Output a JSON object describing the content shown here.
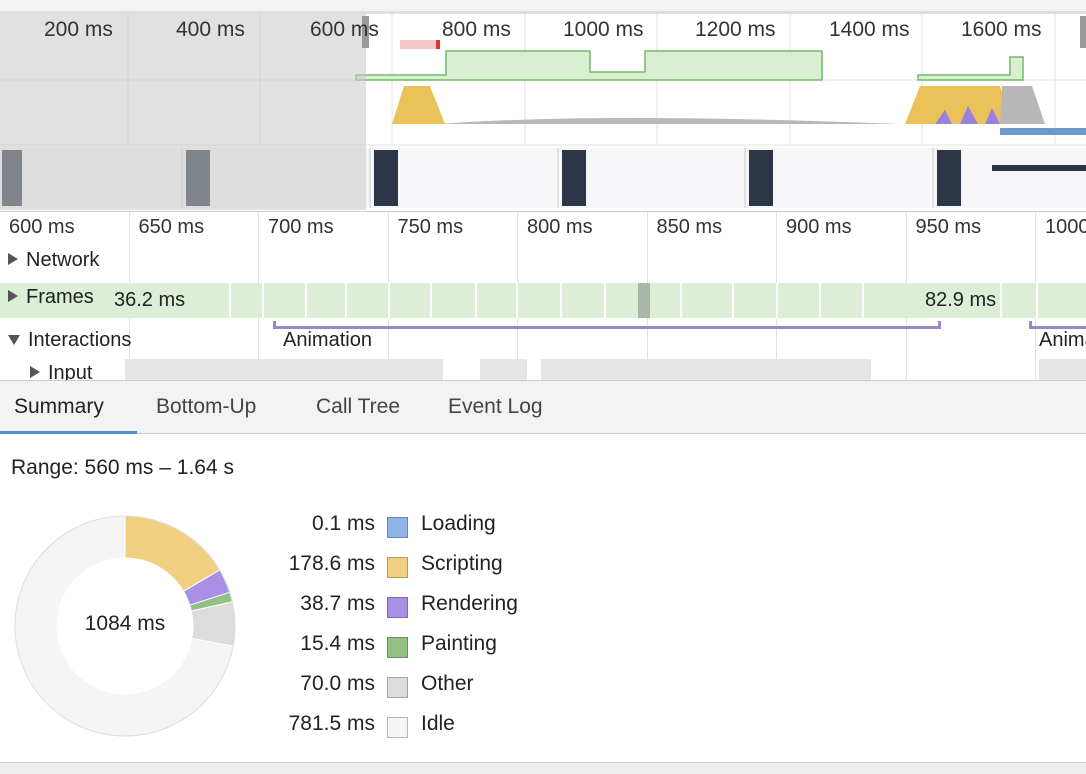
{
  "overview": {
    "time_labels": [
      "200 ms",
      "400 ms",
      "600 ms",
      "800 ms",
      "1000 ms",
      "1200 ms",
      "1400 ms",
      "1600 ms"
    ]
  },
  "detail": {
    "ruler": [
      "600 ms",
      "650 ms",
      "700 ms",
      "750 ms",
      "800 ms",
      "850 ms",
      "900 ms",
      "950 ms",
      "1000 ms"
    ],
    "tracks": {
      "network": "Network",
      "frames": "Frames",
      "interactions": "Interactions",
      "input": "Input"
    },
    "frame_labels": [
      "36.2 ms",
      "82.9 ms"
    ],
    "interaction_labels": [
      "Animation",
      "Animation"
    ]
  },
  "tabs": [
    {
      "label": "Summary",
      "active": true
    },
    {
      "label": "Bottom-Up"
    },
    {
      "label": "Call Tree"
    },
    {
      "label": "Event Log"
    }
  ],
  "summary": {
    "range": "Range: 560 ms – 1.64 s",
    "total": "1084 ms",
    "items": [
      {
        "value": "0.1 ms",
        "name": "Loading",
        "ms": 0.1,
        "color": "#8fb4ea"
      },
      {
        "value": "178.6 ms",
        "name": "Scripting",
        "ms": 178.6,
        "color": "#f0d080"
      },
      {
        "value": "38.7 ms",
        "name": "Rendering",
        "ms": 38.7,
        "color": "#a98fe6"
      },
      {
        "value": "15.4 ms",
        "name": "Painting",
        "ms": 15.4,
        "color": "#93c083"
      },
      {
        "value": "70.0 ms",
        "name": "Other",
        "ms": 70.0,
        "color": "#dcdcdc"
      },
      {
        "value": "781.5 ms",
        "name": "Idle",
        "ms": 781.5,
        "color": "#f5f5f5"
      }
    ]
  }
}
